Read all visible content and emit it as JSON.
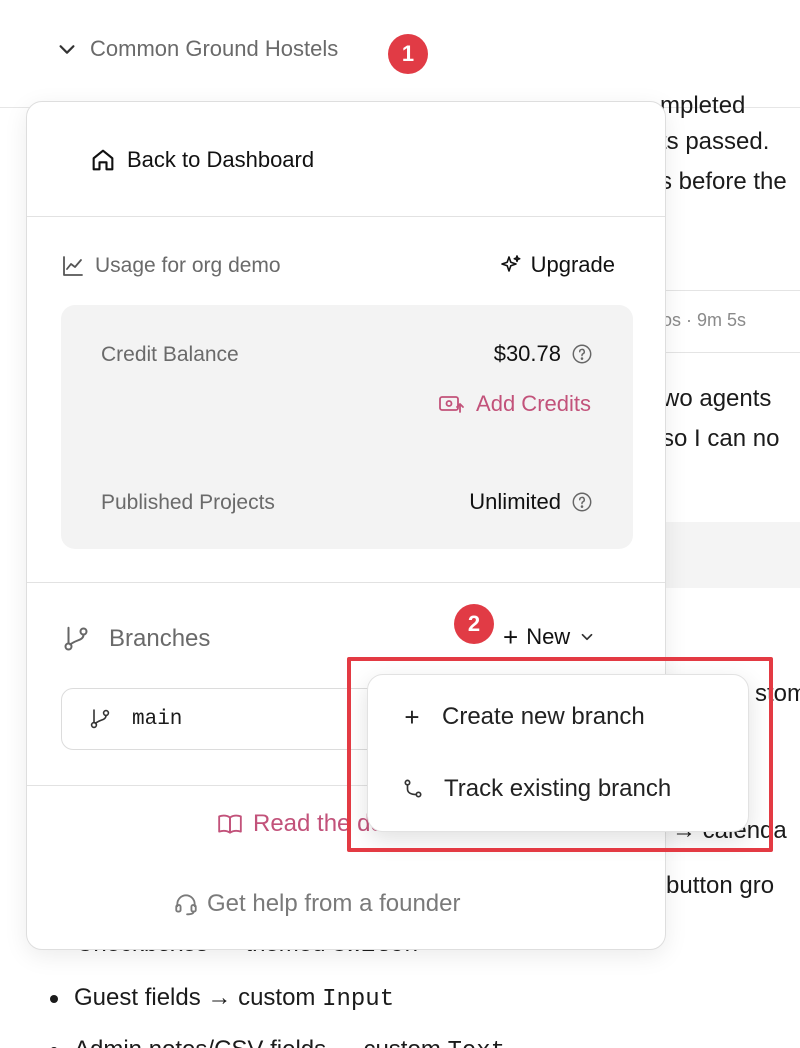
{
  "header": {
    "org_name": "Common Ground Hostels",
    "badge_1": "1"
  },
  "background": {
    "line_1": "mpleted",
    "line_2": "ts passed.",
    "line_3": "s before the",
    "meta": "os · 9m 5s",
    "line_4": "wo agents",
    "line_5": "so I can no",
    "line_6": "stom",
    "line_7": "→ calenda",
    "line_8": "button gro",
    "line_9_a": "Checkboxes → themed ",
    "line_9_b": "Switch",
    "list_1_a": "Guest fields → custom ",
    "list_1_b": "Input",
    "list_2_a": "Admin notes/CSV fields → custom ",
    "list_2_b": "Text"
  },
  "panel": {
    "back_label": "Back to Dashboard",
    "usage_label": "Usage for org demo",
    "upgrade_label": "Upgrade",
    "credit_balance_label": "Credit Balance",
    "credit_balance_value": "$30.78",
    "add_credits_label": "Add Credits",
    "published_projects_label": "Published Projects",
    "published_projects_value": "Unlimited",
    "branches_label": "Branches",
    "badge_2": "2",
    "new_label": "New",
    "branch_main": "main",
    "read_docs_label": "Read the docs",
    "get_help_label": "Get help from a founder"
  },
  "dropdown": {
    "create_label": "Create new branch",
    "track_label": "Track existing branch"
  },
  "colors": {
    "accent": "#c2527a",
    "badge": "#e13b45",
    "highlight": "#e33a43"
  }
}
